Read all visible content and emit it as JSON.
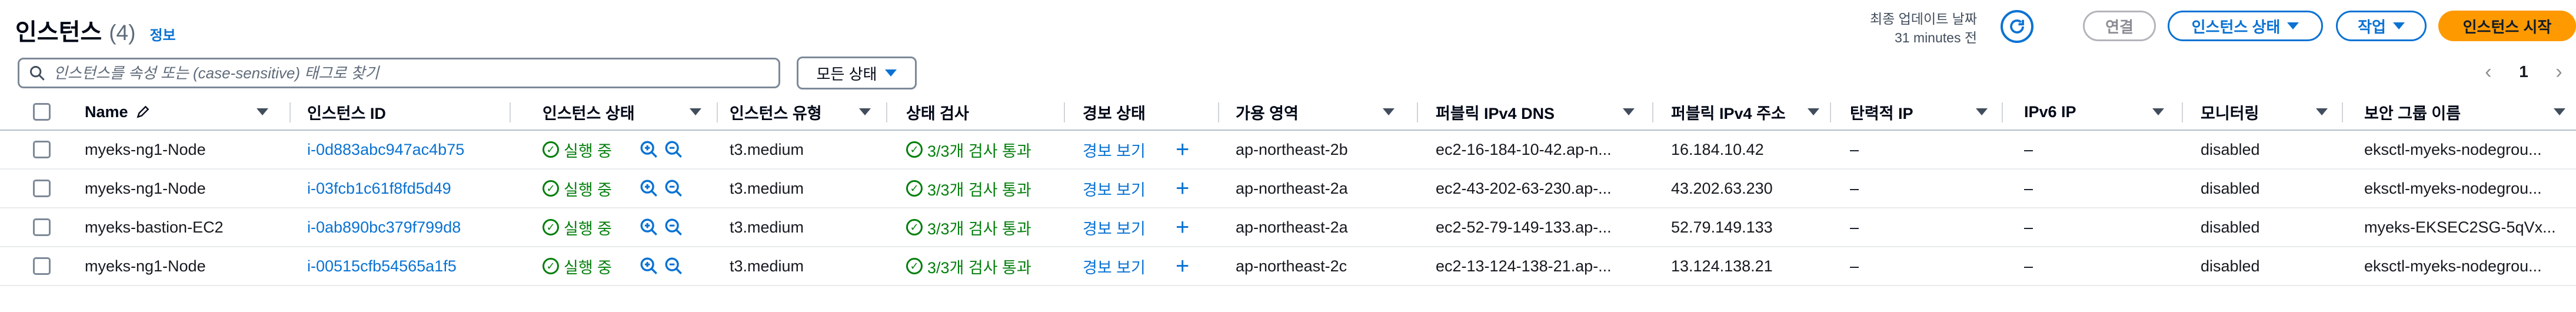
{
  "header": {
    "title": "인스턴스",
    "count": "(4)",
    "info": "정보",
    "last_updated_line1": "최종 업데이트 날짜",
    "last_updated_line2": "31 minutes 전",
    "connect_label": "연결",
    "instance_state_label": "인스턴스 상태",
    "actions_label": "작업",
    "launch_label": "인스턴스 시작"
  },
  "filter": {
    "search_placeholder": "인스턴스를 속성 또는 (case-sensitive) 태그로 찾기",
    "state_filter": "모든 상태"
  },
  "pagination": {
    "prev": "‹",
    "page": "1",
    "next": "›"
  },
  "table": {
    "columns": [
      "Name",
      "인스턴스 ID",
      "인스턴스 상태",
      "인스턴스 유형",
      "상태 검사",
      "경보 상태",
      "가용 영역",
      "퍼블릭 IPv4 DNS",
      "퍼블릭 IPv4 주소",
      "탄력적 IP",
      "IPv6 IP",
      "모니터링",
      "보안 그룹 이름"
    ],
    "rows": [
      {
        "name": "myeks-ng1-Node",
        "id": "i-0d883abc947ac4b75",
        "state": "실행 중",
        "type": "t3.medium",
        "check": "3/3개 검사 통과",
        "alarm": "경보 보기",
        "az": "ap-northeast-2b",
        "dns": "ec2-16-184-10-42.ap-n...",
        "ipv4": "16.184.10.42",
        "eip": "–",
        "ipv6": "–",
        "monitoring": "disabled",
        "sg": "eksctl-myeks-nodegrou..."
      },
      {
        "name": "myeks-ng1-Node",
        "id": "i-03fcb1c61f8fd5d49",
        "state": "실행 중",
        "type": "t3.medium",
        "check": "3/3개 검사 통과",
        "alarm": "경보 보기",
        "az": "ap-northeast-2a",
        "dns": "ec2-43-202-63-230.ap-...",
        "ipv4": "43.202.63.230",
        "eip": "–",
        "ipv6": "–",
        "monitoring": "disabled",
        "sg": "eksctl-myeks-nodegrou..."
      },
      {
        "name": "myeks-bastion-EC2",
        "id": "i-0ab890bc379f799d8",
        "state": "실행 중",
        "type": "t3.medium",
        "check": "3/3개 검사 통과",
        "alarm": "경보 보기",
        "az": "ap-northeast-2a",
        "dns": "ec2-52-79-149-133.ap-...",
        "ipv4": "52.79.149.133",
        "eip": "–",
        "ipv6": "–",
        "monitoring": "disabled",
        "sg": "myeks-EKSEC2SG-5qVx..."
      },
      {
        "name": "myeks-ng1-Node",
        "id": "i-00515cfb54565a1f5",
        "state": "실행 중",
        "type": "t3.medium",
        "check": "3/3개 검사 통과",
        "alarm": "경보 보기",
        "az": "ap-northeast-2c",
        "dns": "ec2-13-124-138-21.ap-...",
        "ipv4": "13.124.138.21",
        "eip": "–",
        "ipv6": "–",
        "monitoring": "disabled",
        "sg": "eksctl-myeks-nodegrou..."
      }
    ]
  },
  "colors": {
    "link": "#0972d3",
    "success": "#037f0c",
    "primary_button": "#ff9900"
  }
}
